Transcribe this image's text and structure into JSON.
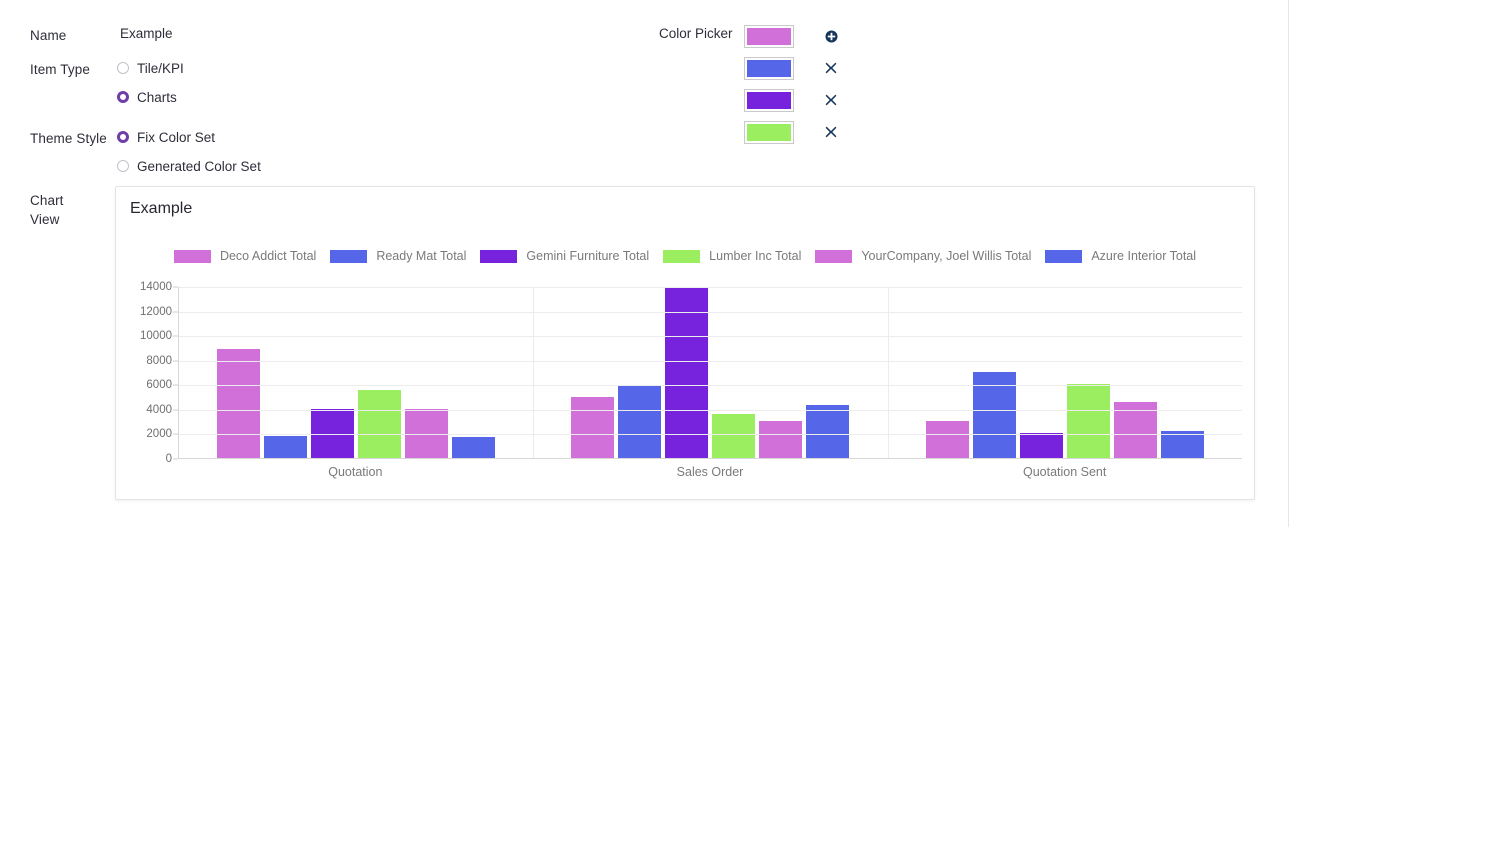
{
  "form": {
    "name_label": "Name",
    "name_value": "Example",
    "item_type_label": "Item Type",
    "item_type_options": [
      {
        "label": "Tile/KPI",
        "selected": false
      },
      {
        "label": "Charts",
        "selected": true
      }
    ],
    "theme_style_label": "Theme Style",
    "theme_style_options": [
      {
        "label": "Fix Color Set",
        "selected": true
      },
      {
        "label": "Generated Color Set",
        "selected": false
      }
    ],
    "chart_view_label": "Chart\nView"
  },
  "color_picker": {
    "label": "Color Picker",
    "rows": [
      {
        "color": "#d070d8",
        "action": "add",
        "action_icon": "plus-circle-icon"
      },
      {
        "color": "#5566e8",
        "action": "remove",
        "action_icon": "close-icon"
      },
      {
        "color": "#7722dd",
        "action": "remove",
        "action_icon": "close-icon"
      },
      {
        "color": "#9bee60",
        "action": "remove",
        "action_icon": "close-icon"
      }
    ]
  },
  "chart_data": {
    "type": "bar",
    "title": "Example",
    "xlabel": "",
    "ylabel": "",
    "ylim": [
      0,
      14000
    ],
    "yticks": [
      0,
      2000,
      4000,
      6000,
      8000,
      10000,
      12000,
      14000
    ],
    "grid": true,
    "legend_position": "top-center",
    "categories": [
      "Quotation",
      "Sales Order",
      "Quotation Sent"
    ],
    "series": [
      {
        "name": "Deco Addict Total",
        "color": "#d070d8",
        "values": [
          8900,
          5000,
          3000
        ]
      },
      {
        "name": "Ready Mat Total",
        "color": "#5566e8",
        "values": [
          1800,
          5950,
          7000
        ]
      },
      {
        "name": "Gemini Furniture Total",
        "color": "#7722dd",
        "values": [
          4000,
          13900,
          2000
        ]
      },
      {
        "name": "Lumber Inc Total",
        "color": "#9bee60",
        "values": [
          5500,
          3600,
          6000
        ]
      },
      {
        "name": "YourCompany, Joel Willis Total",
        "color": "#d070d8",
        "values": [
          4000,
          3000,
          4550
        ]
      },
      {
        "name": "Azure Interior Total",
        "color": "#5566e8",
        "values": [
          1750,
          4350,
          2200
        ]
      }
    ]
  }
}
